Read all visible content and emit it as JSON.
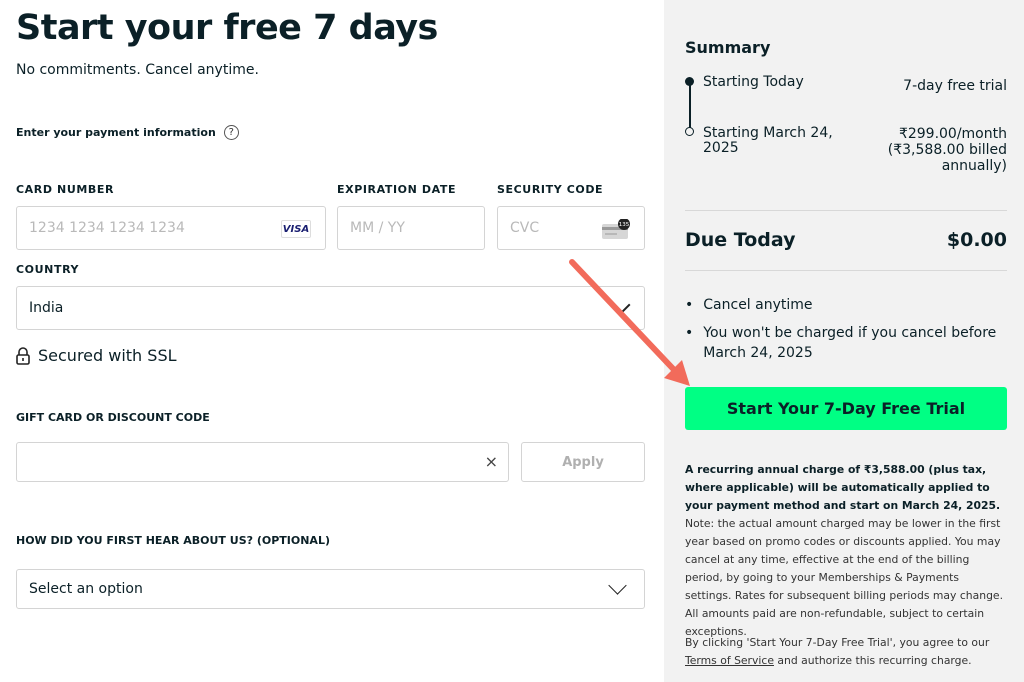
{
  "header": {
    "title": "Start your free 7 days",
    "subtitle": "No commitments. Cancel anytime."
  },
  "payment": {
    "section_label": "Enter your payment information",
    "help_icon": "?",
    "card_number_label": "CARD NUMBER",
    "card_number_placeholder": "1234 1234 1234 1234",
    "card_brand": "VISA",
    "expiration_label": "EXPIRATION DATE",
    "expiration_placeholder": "MM / YY",
    "security_label": "SECURITY CODE",
    "security_placeholder": "CVC",
    "cvc_badge": "135",
    "country_label": "COUNTRY",
    "country_value": "India",
    "ssl_text": "Secured with SSL"
  },
  "gift": {
    "label": "GIFT CARD OR DISCOUNT CODE",
    "clear_icon": "×",
    "apply_label": "Apply"
  },
  "hear": {
    "label": "HOW DID YOU FIRST HEAR ABOUT US? (OPTIONAL)",
    "value": "Select an option"
  },
  "summary": {
    "title": "Summary",
    "row1_left": "Starting Today",
    "row1_right": "7-day free trial",
    "row2_left_1": "Starting March 24,",
    "row2_left_2": "2025",
    "row2_right_1": "₹299.00/month",
    "row2_right_2": "(₹3,588.00 billed",
    "row2_right_3": "annually)",
    "due_label": "Due Today",
    "due_value": "$0.00",
    "bullet1": "Cancel anytime",
    "bullet2_1": "You won't be charged if you cancel before",
    "bullet2_2": "March 24, 2025",
    "cta_label": "Start Your 7-Day Free Trial",
    "legal_bold": "A recurring annual charge of ₹3,588.00 (plus tax, where applicable) will be automatically applied to your payment method and start on March 24, 2025.",
    "legal_rest": " Note: the actual amount charged may be lower in the first year based on promo codes or discounts applied. You may cancel at any time, effective at the end of the billing period, by going to your Memberships & Payments settings. Rates for subsequent billing periods may change. All amounts paid are non-refundable, subject to certain exceptions.",
    "agree_1": "By clicking 'Start Your 7-Day Free Trial', you agree to our",
    "agree_link": "Terms of Service",
    "agree_2": " and authorize this recurring charge."
  },
  "colors": {
    "cta": "#00ff84",
    "text": "#0b2027",
    "summary_bg": "#f2f2f2",
    "arrow": "#f26b5b"
  }
}
